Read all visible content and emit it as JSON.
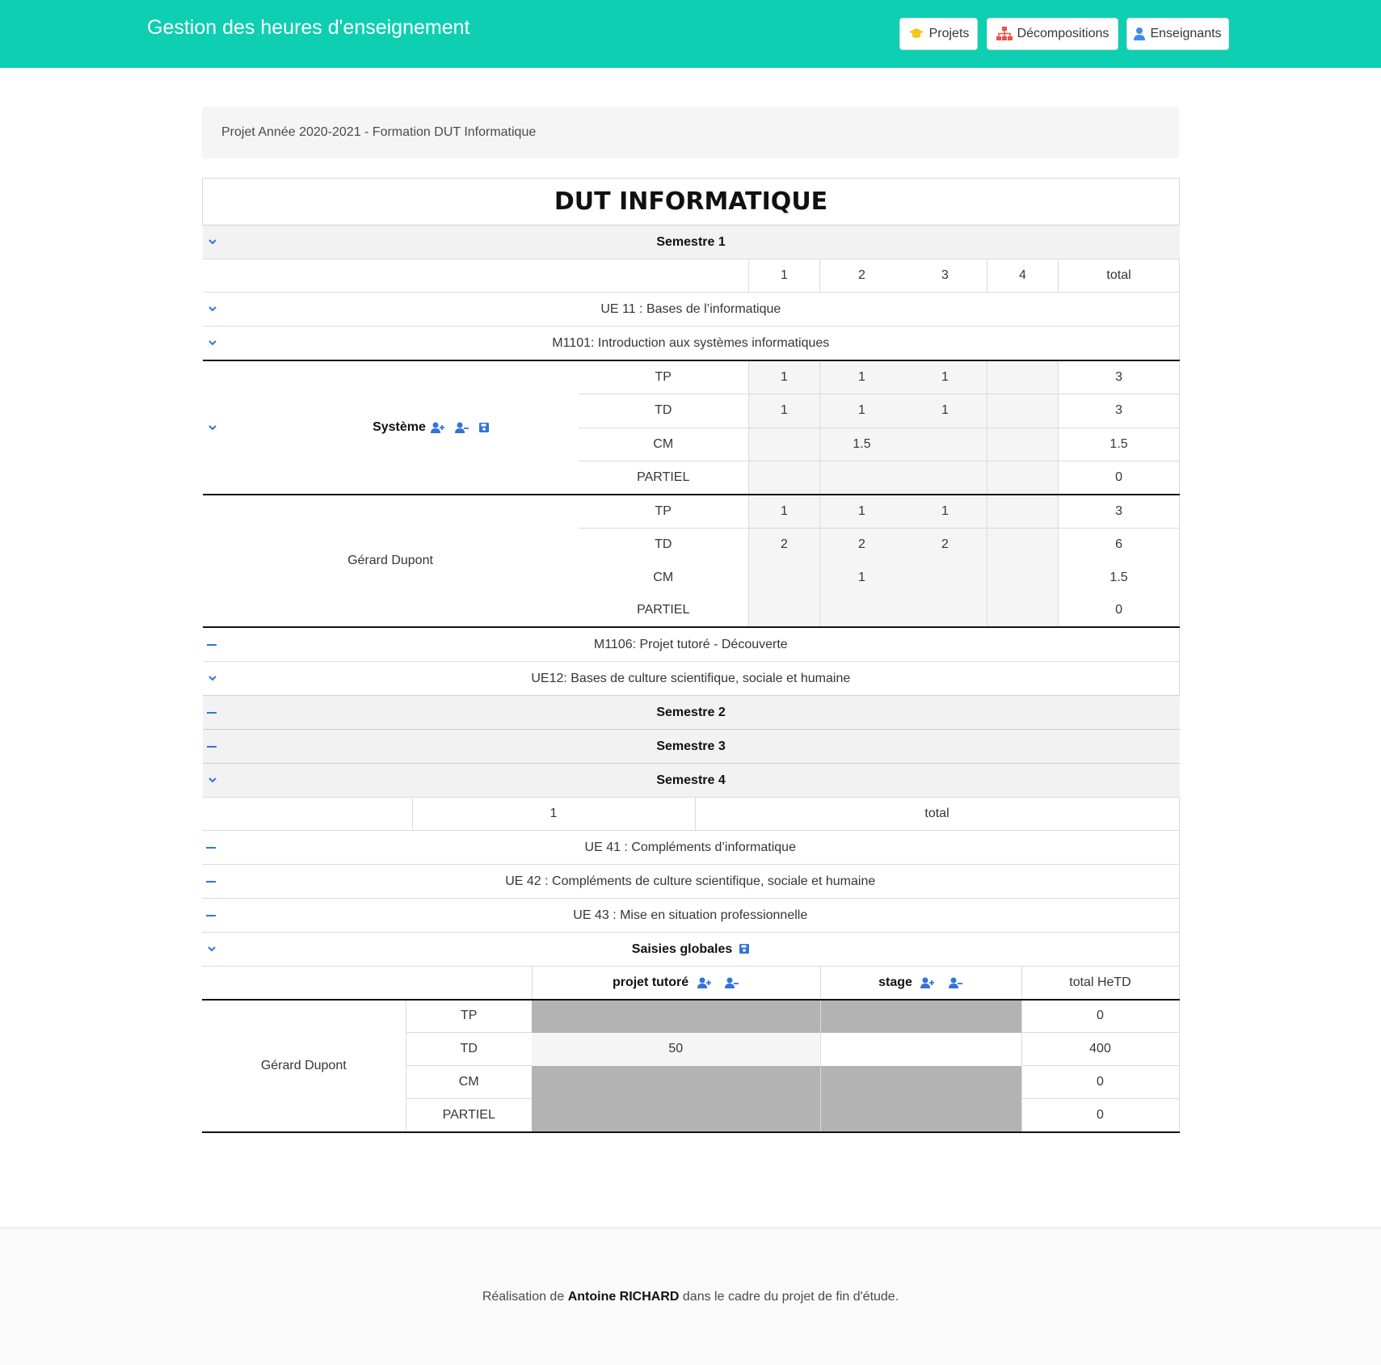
{
  "app": {
    "title": "Gestion des heures d'enseignement"
  },
  "nav": [
    {
      "label": "Projets",
      "icon": "graduation-cap-icon",
      "color": "#f5c518"
    },
    {
      "label": "Décompositions",
      "icon": "sitemap-icon",
      "color": "#e8534a"
    },
    {
      "label": "Enseignants",
      "icon": "user-icon",
      "color": "#3b8ee8"
    }
  ],
  "breadcrumb": "Projet Année 2020-2021 - Formation DUT Informatique",
  "formation": "DUT INFORMATIQUE",
  "semestre1": {
    "label": "Semestre 1",
    "columns": [
      "1",
      "2",
      "3",
      "4",
      "total"
    ],
    "ue11": "UE 11 : Bases de l’informatique",
    "m1101": "M1101: Introduction aux systèmes informatiques",
    "groupe": {
      "name": "Système",
      "rows": [
        {
          "type": "TP",
          "c1": "1",
          "c2": "1",
          "c3": "1",
          "c4": "",
          "total": "3"
        },
        {
          "type": "TD",
          "c1": "1",
          "c2": "1",
          "c3": "1",
          "c4": "",
          "total": "3"
        },
        {
          "type": "CM",
          "c1": "",
          "c2": "1.5",
          "c3": "",
          "c4": "",
          "total": "1.5"
        },
        {
          "type": "PARTIEL",
          "c1": "",
          "c2": "",
          "c3": "",
          "c4": "",
          "total": "0"
        }
      ]
    },
    "enseignant": {
      "name": "Gérard Dupont",
      "rows": [
        {
          "type": "TP",
          "c1": "1",
          "c2": "1",
          "c3": "1",
          "c4": "",
          "total": "3"
        },
        {
          "type": "TD",
          "c1": "2",
          "c2": "2",
          "c3": "2",
          "c4": "",
          "total": "6"
        },
        {
          "type": "CM",
          "c1": "",
          "c2": "1",
          "c3": "",
          "c4": "",
          "total": "1.5"
        },
        {
          "type": "PARTIEL",
          "c1": "",
          "c2": "",
          "c3": "",
          "c4": "",
          "total": "0"
        }
      ]
    },
    "m1106": "M1106: Projet tutoré - Découverte",
    "ue12": "UE12: Bases de culture scientifique, sociale et humaine"
  },
  "semestre2": "Semestre 2",
  "semestre3": "Semestre 3",
  "semestre4": {
    "label": "Semestre 4",
    "columns": [
      "1",
      "total"
    ],
    "ue41": "UE 41 : Compléments d’informatique",
    "ue42": "UE 42 : Compléments de culture scientifique, sociale et humaine",
    "ue43": "UE 43 : Mise en situation professionnelle"
  },
  "saisies": {
    "label": "Saisies globales",
    "columns": [
      "projet tutoré",
      "stage",
      "total HeTD"
    ],
    "enseignant": "Gérard Dupont",
    "rows": [
      {
        "type": "TP",
        "projet": "",
        "stage": "",
        "total": "0"
      },
      {
        "type": "TD",
        "projet": "50",
        "stage": "",
        "total": "400"
      },
      {
        "type": "CM",
        "projet": "",
        "stage": "",
        "total": "0"
      },
      {
        "type": "PARTIEL",
        "projet": "",
        "stage": "",
        "total": "0"
      }
    ]
  },
  "footer": {
    "prefix": "Réalisation de",
    "author": "Antoine RICHARD",
    "suffix": "dans le cadre du projet de fin d'étude."
  }
}
